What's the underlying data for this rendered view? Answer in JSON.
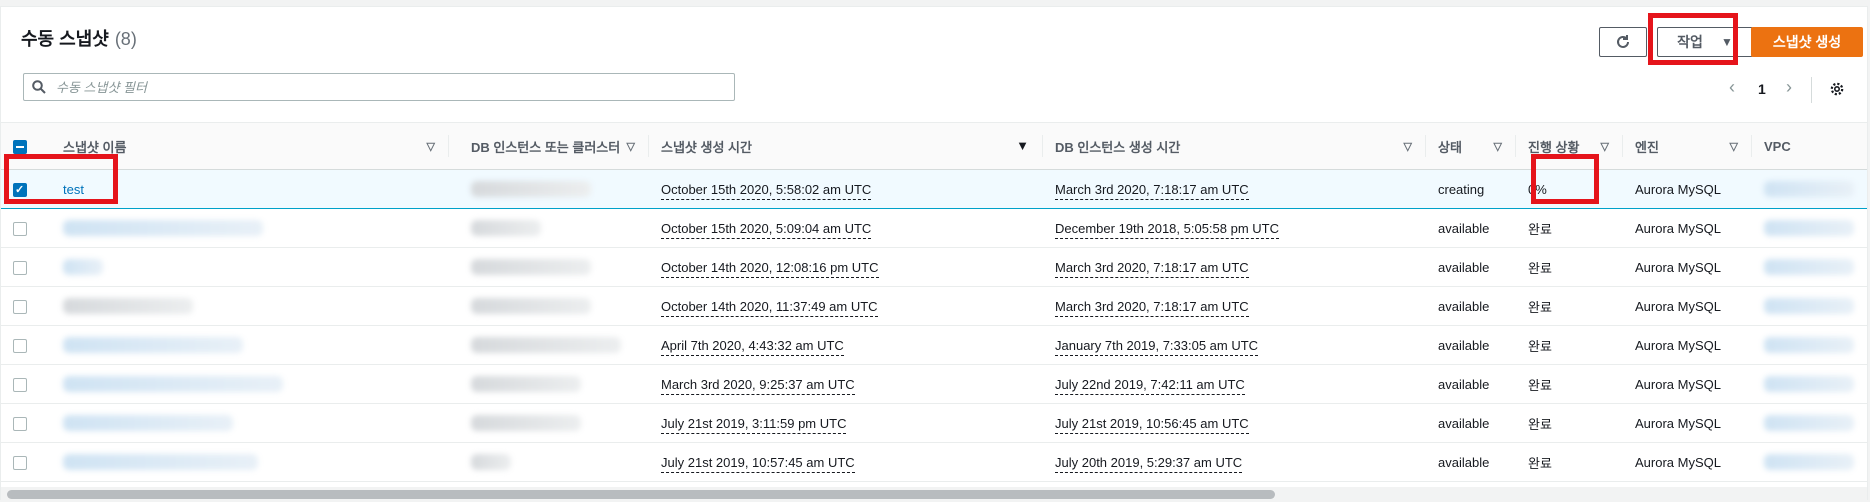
{
  "header": {
    "title": "수동 스냅샷",
    "count": "(8)",
    "actions_label": "작업",
    "create_label": "스냅샷 생성"
  },
  "filter": {
    "placeholder": "수동 스냅샷 필터"
  },
  "pagination": {
    "page": "1"
  },
  "columns": {
    "name": "스냅샷 이름",
    "instance": "DB 인스턴스 또는 클러스터",
    "snapshot_time": "스냅샷 생성 시간",
    "instance_time": "DB 인스턴스 생성 시간",
    "status": "상태",
    "progress": "진행 상황",
    "engine": "엔진",
    "vpc": "VPC"
  },
  "rows": [
    {
      "name": "test",
      "snapshot_time": "October 15th 2020, 5:58:02 am UTC",
      "instance_time": "March 3rd 2020, 7:18:17 am UTC",
      "status": "creating",
      "progress": "0%",
      "engine": "Aurora MySQL"
    },
    {
      "name": "",
      "snapshot_time": "October 15th 2020, 5:09:04 am UTC",
      "instance_time": "December 19th 2018, 5:05:58 pm UTC",
      "status": "available",
      "progress": "완료",
      "engine": "Aurora MySQL"
    },
    {
      "name": "",
      "snapshot_time": "October 14th 2020, 12:08:16 pm UTC",
      "instance_time": "March 3rd 2020, 7:18:17 am UTC",
      "status": "available",
      "progress": "완료",
      "engine": "Aurora MySQL"
    },
    {
      "name": "",
      "snapshot_time": "October 14th 2020, 11:37:49 am UTC",
      "instance_time": "March 3rd 2020, 7:18:17 am UTC",
      "status": "available",
      "progress": "완료",
      "engine": "Aurora MySQL"
    },
    {
      "name": "",
      "snapshot_time": "April 7th 2020, 4:43:32 am UTC",
      "instance_time": "January 7th 2019, 7:33:05 am UTC",
      "status": "available",
      "progress": "완료",
      "engine": "Aurora MySQL"
    },
    {
      "name": "",
      "snapshot_time": "March 3rd 2020, 9:25:37 am UTC",
      "instance_time": "July 22nd 2019, 7:42:11 am UTC",
      "status": "available",
      "progress": "완료",
      "engine": "Aurora MySQL"
    },
    {
      "name": "",
      "snapshot_time": "July 21st 2019, 3:11:59 pm UTC",
      "instance_time": "July 21st 2019, 10:56:45 am UTC",
      "status": "available",
      "progress": "완료",
      "engine": "Aurora MySQL"
    },
    {
      "name": "",
      "snapshot_time": "July 21st 2019, 10:57:45 am UTC",
      "instance_time": "July 20th 2019, 5:29:37 am UTC",
      "status": "available",
      "progress": "완료",
      "engine": "Aurora MySQL"
    }
  ],
  "icons": {
    "refresh": "refresh-icon",
    "search": "search-icon",
    "gear": "gear-icon",
    "prev": "chevron-left-icon",
    "next": "chevron-right-icon"
  },
  "colors": {
    "primary": "#ec7211",
    "link": "#0073bb",
    "highlight": "#e5141b"
  }
}
